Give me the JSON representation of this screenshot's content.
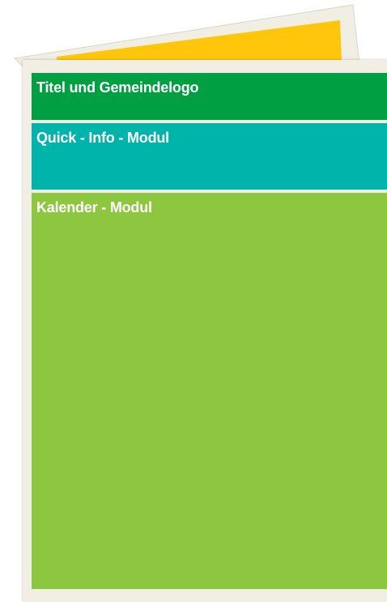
{
  "colors": {
    "page_background": "#f1efe4",
    "back_page_accent": "#ffc60b",
    "title_module": "#009f42",
    "quick_info_module": "#00b3ab",
    "calendar_module": "#8dc63f",
    "label_text": "#ffffff"
  },
  "modules": {
    "title": {
      "label": "Titel und Gemeindelogo"
    },
    "quick_info": {
      "label": "Quick - Info - Modul"
    },
    "calendar": {
      "label": "Kalender - Modul"
    }
  }
}
